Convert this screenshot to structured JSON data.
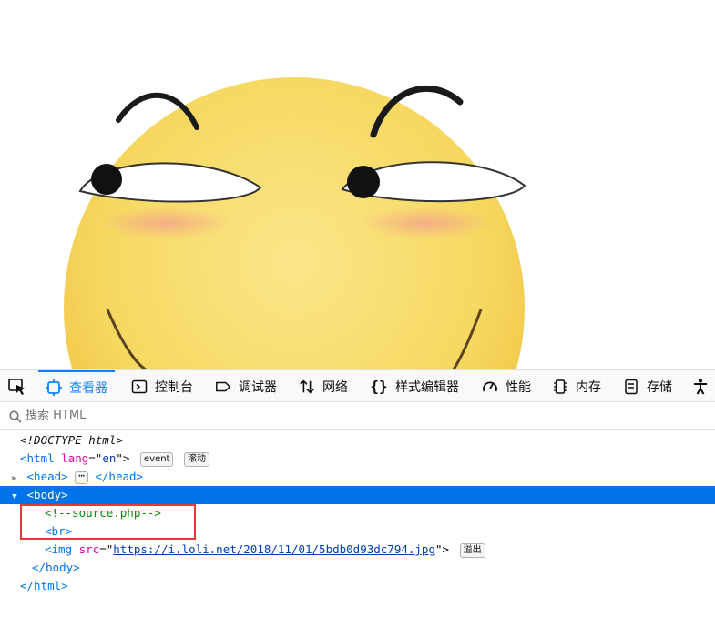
{
  "devtools": {
    "tabs": [
      {
        "label": "查看器",
        "icon": "inspector-icon",
        "active": true
      },
      {
        "label": "控制台",
        "icon": "console-icon"
      },
      {
        "label": "调试器",
        "icon": "debugger-icon"
      },
      {
        "label": "网络",
        "icon": "network-icon"
      },
      {
        "label": "样式编辑器",
        "icon": "style-editor-icon"
      },
      {
        "label": "性能",
        "icon": "performance-icon"
      },
      {
        "label": "内存",
        "icon": "memory-icon"
      },
      {
        "label": "存储",
        "icon": "storage-icon"
      },
      {
        "label": "",
        "icon": "accessibility-icon"
      }
    ],
    "search": {
      "placeholder": "搜索 HTML"
    },
    "markup": {
      "doctype": "<!DOCTYPE html>",
      "html_open": "<html",
      "html_attr_name": "lang",
      "html_attr_eq": "=\"",
      "html_attr_value": "en",
      "html_attr_close": "\">",
      "badge_event": "event",
      "badge_scroll": "滚动",
      "head_open": "<head>",
      "head_close": "</head>",
      "head_ellipsis": "⋯",
      "body_open": "<body>",
      "comment": "<!--source.php-->",
      "br": "<br>",
      "img_open": "<img",
      "img_attr_name": "src",
      "img_attr_eq": "=\"",
      "img_src": "https://i.loli.net/2018/11/01/5bdb0d93dc794.jpg",
      "img_close": "\">",
      "badge_overflow": "溢出",
      "body_close": "</body>",
      "html_close": "</html>"
    }
  },
  "colors": {
    "accent": "#0a84ff",
    "selection": "#0074e8",
    "highlight_box": "#e53935",
    "face": "#f6d860"
  }
}
